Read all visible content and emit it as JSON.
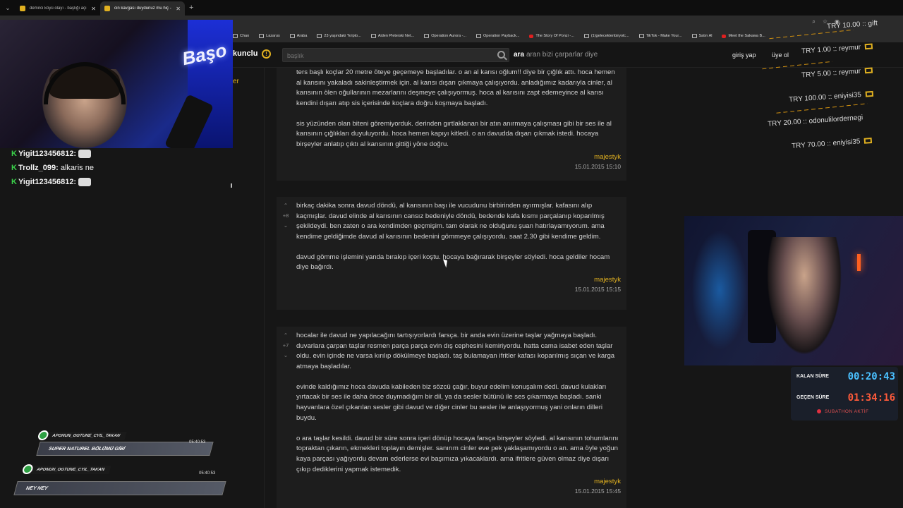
{
  "browser": {
    "tabs": [
      {
        "title": "demirci köyü olayı - başlığı açı"
      },
      {
        "title": "cin kavgası duydunuz mu hiç -"
      }
    ],
    "bookmarks": [
      "Chao",
      "Lazarus",
      "Araba",
      "23 yaşındaki \"kripto...",
      "Aiden Pleterski Net...",
      "Operation Aurora -...",
      "Operation Payback...",
      "The Story Of Ponzi -...",
      "(1)gelecektenbiryolc...",
      "TikTok - Make Your...",
      "Satın Al",
      "Meet the Sakawa B..."
    ]
  },
  "site": {
    "brand": "kunclu",
    "search_placeholder": "başlık",
    "search_button": "ara",
    "search_hint": "aran bizi çarparlar diye",
    "login": "giriş yap",
    "signup": "üye ol",
    "menu_fragment": "er"
  },
  "entries": [
    {
      "paragraphs": [
        "ters başlı koçlar 20 metre öteye geçemeye başladılar. o an al karısı oğlum!! diye bir çığlık attı. hoca hemen al karısını yakaladı sakinleştirmek için. al karısı dışarı çıkmaya çalışıyordu. anladığımız kadarıyla cinler, al karısının ölen oğullarının mezarlarını deşmeye çalışıyormuş. hoca al karısını zapt edemeyince al karısı kendini dışarı atıp sis içerisinde koçlara doğru koşmaya başladı.",
        "sis yüzünden olan biteni göremiyorduk. derinden gırtlaklanan bir atın anırmaya çalışması gibi bir ses ile al karısının çığlıkları duyuluyordu. hoca hemen kapıyı kitledi. o an davudda dışarı çıkmak istedi. hocaya birşeyler anlatıp çıktı al karısının gittiği yöne doğru."
      ],
      "author": "majestyk",
      "date": "15.01.2015 15:10"
    },
    {
      "votes": "+8",
      "paragraphs": [
        "birkaç dakika sonra davud döndü, al karısının başı ile vucudunu birbirinden ayırmışlar. kafasını alıp kaçmışlar. davud elinde al karısının cansız bedeniyle döndü, bedende kafa kısmı parçalanıp koparılmış şekildeydi. ben zaten o ara kendimden geçmişim. tam olarak ne olduğunu şuan hatırlayamıyorum. ama kendime geldiğimde davud al karısının bedenini gömmeye çalışıyordu. saat 2.30 gibi kendime geldim.",
        "davud gömme işlemini yanda bırakıp içeri koştu. hocaya bağırarak birşeyler söyledi. hoca geldiler hocam diye bağırdı."
      ],
      "author": "majestyk",
      "date": "15.01.2015 15:15"
    },
    {
      "votes": "+7",
      "paragraphs": [
        "hocalar ile davud ne yapılacağını tartışıyorlardı farsça. bir anda evin üzerine taşlar yağmaya başladı. duvarlara çarpan taşlar resmen parça parça evin dış cephesini kemiriyordu. hatta cama isabet eden taşlar oldu. evin içinde ne varsa kırılıp dökülmeye başladı. taş bulamayan ifritler kafası koparılmış sıçan ve karga atmaya başladılar.",
        "evinde kaldığımız hoca davuda kabileden biz sözcü çağır, buyur edelim konuşalım dedi. davud kulakları yırtacak bir ses ile daha önce duymadığım bir dil, ya da sesler bütünü ile ses çıkarmaya başladı. sanki hayvanlara özel çıkarılan sesler gibi davud ve diğer cinler bu sesler ile anlaşıyormuş yani onların dilleri buydu.",
        "o ara taşlar kesildi. davud bir süre sonra içeri dönüp hocaya farsça birşeyler söyledi. al karısının tohumlarını topraktan çıkarın, ekmekleri toplayın demişler. sanırım cinler eve pek yaklaşamıyordu o an. ama öyle yoğun kaya parçası yağıyordu devam ederlerse evi başımıza yıkacaklardı. ama ifritlere güven olmaz diye dışarı çıkıp dediklerini yapmak istemedik."
      ],
      "author": "majestyk",
      "date": "15.01.2015 15:45"
    }
  ],
  "stream": {
    "cam_logo": "Başo",
    "chat": [
      {
        "user": "Yigit123456812:",
        "msg": ""
      },
      {
        "user": "Trollz_099:",
        "msg": "alkaris ne"
      },
      {
        "user": "Yigit123456812:",
        "msg": ""
      }
    ],
    "donations": [
      {
        "text": "TRY 10.00 :: gift"
      },
      {
        "text": "TRY 1.00 :: reymur"
      },
      {
        "text": "TRY 5.00 :: reymur"
      },
      {
        "text": "TRY 100.00 :: eniyisi35"
      },
      {
        "text": "TRY 20.00 :: odonulilordernegi"
      },
      {
        "text": "TRY 70.00 :: eniyisi35"
      }
    ],
    "timer": {
      "remaining_label": "KALAN SÜRE",
      "remaining_value": "00:20:43",
      "elapsed_label": "GEÇEN SÜRE",
      "elapsed_value": "01:34:16",
      "status": "SUBATHON AKTİF"
    },
    "notifications": [
      {
        "user": "APONUN_OGTUNE_CYIL_TAKAN",
        "msg": "SUPER NATUREL BÖLÜMÜ GİBİ",
        "time": "05:40:53"
      },
      {
        "user": "APONUN_OGTUNE_CYIL_TAKAN",
        "msg": "NEY NEY",
        "time": "05:40:53"
      }
    ]
  },
  "colors": {
    "accent": "#e0b020",
    "chat_badge": "#3ad24a",
    "timer_remaining": "#4ac0ff",
    "timer_elapsed": "#ff5a3a"
  }
}
